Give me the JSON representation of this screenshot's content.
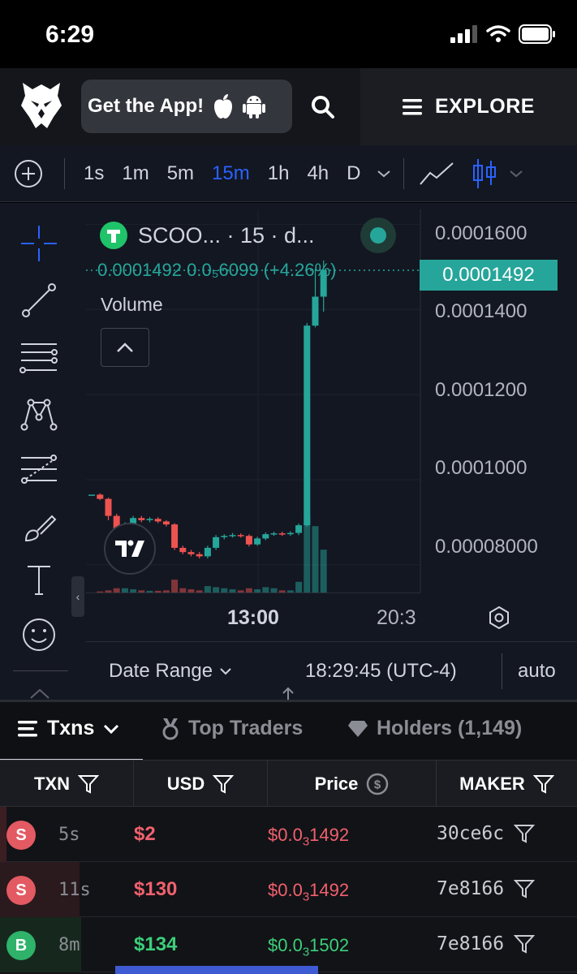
{
  "status": {
    "time": "6:29"
  },
  "nav": {
    "get_app_label": "Get the App!",
    "explore_label": "EXPLORE"
  },
  "toolbar": {
    "intervals": [
      "1s",
      "1m",
      "5m",
      "15m",
      "1h",
      "4h",
      "D"
    ],
    "active_interval": "15m"
  },
  "chart": {
    "legend_title": "SCOO...   · 15 · d...",
    "price_line": "0.0001492  0.0₅6099 (+4.26%)",
    "volume_label": "Volume",
    "current_price": "0.0001492",
    "y_ticks": [
      "0.0001600",
      "0.0001400",
      "0.0001200",
      "0.0001000",
      "0.00008000"
    ],
    "x_ticks": [
      "13:00",
      "20:3"
    ],
    "date_range_label": "Date Range",
    "clock": "18:29:45 (UTC-4)",
    "auto_label": "auto",
    "accent_up": "#26a69a",
    "accent_down": "#ef5350"
  },
  "chart_data": {
    "type": "candlestick",
    "title": "",
    "x_ticks": [
      "13:00",
      "20:3"
    ],
    "ylim": [
      7.35e-05,
      0.0001635
    ],
    "candles": [
      {
        "o": 9.65e-05,
        "c": 9.65e-05,
        "h": 9.65e-05,
        "l": 9.65e-05,
        "v": 0.0
      },
      {
        "o": 9.65e-05,
        "c": 9.55e-05,
        "h": 9.68e-05,
        "l": 9.52e-05,
        "v": 0.05
      },
      {
        "o": 9.55e-05,
        "c": 9.15e-05,
        "h": 9.58e-05,
        "l": 9.05e-05,
        "v": 0.1
      },
      {
        "o": 9.15e-05,
        "c": 8.75e-05,
        "h": 9.2e-05,
        "l": 8.68e-05,
        "v": 0.2
      },
      {
        "o": 8.75e-05,
        "c": 8.95e-05,
        "h": 9e-05,
        "l": 8.7e-05,
        "v": 0.2
      },
      {
        "o": 8.95e-05,
        "c": 9.1e-05,
        "h": 9.15e-05,
        "l": 8.9e-05,
        "v": 0.15
      },
      {
        "o": 9.1e-05,
        "c": 9.05e-05,
        "h": 9.15e-05,
        "l": 9e-05,
        "v": 0.1
      },
      {
        "o": 9.05e-05,
        "c": 9.08e-05,
        "h": 9.12e-05,
        "l": 9e-05,
        "v": 0.08
      },
      {
        "o": 9.08e-05,
        "c": 9.02e-05,
        "h": 9.12e-05,
        "l": 8.98e-05,
        "v": 0.08
      },
      {
        "o": 9.02e-05,
        "c": 8.95e-05,
        "h": 9.05e-05,
        "l": 8.9e-05,
        "v": 0.1
      },
      {
        "o": 8.95e-05,
        "c": 8.4e-05,
        "h": 8.98e-05,
        "l": 8.35e-05,
        "v": 0.6
      },
      {
        "o": 8.4e-05,
        "c": 8.3e-05,
        "h": 8.45e-05,
        "l": 8.25e-05,
        "v": 0.2
      },
      {
        "o": 8.3e-05,
        "c": 8.25e-05,
        "h": 8.35e-05,
        "l": 8.2e-05,
        "v": 0.15
      },
      {
        "o": 8.25e-05,
        "c": 8.2e-05,
        "h": 8.3e-05,
        "l": 8.15e-05,
        "v": 0.1
      },
      {
        "o": 8.2e-05,
        "c": 8.4e-05,
        "h": 8.45e-05,
        "l": 8.15e-05,
        "v": 0.3
      },
      {
        "o": 8.4e-05,
        "c": 8.65e-05,
        "h": 8.7e-05,
        "l": 8.35e-05,
        "v": 0.25
      },
      {
        "o": 8.65e-05,
        "c": 8.68e-05,
        "h": 8.72e-05,
        "l": 8.6e-05,
        "v": 0.2
      },
      {
        "o": 8.68e-05,
        "c": 8.7e-05,
        "h": 8.75e-05,
        "l": 8.64e-05,
        "v": 0.15
      },
      {
        "o": 8.7e-05,
        "c": 8.68e-05,
        "h": 8.74e-05,
        "l": 8.64e-05,
        "v": 0.1
      },
      {
        "o": 8.68e-05,
        "c": 8.48e-05,
        "h": 8.72e-05,
        "l": 8.43e-05,
        "v": 0.2
      },
      {
        "o": 8.48e-05,
        "c": 8.62e-05,
        "h": 8.66e-05,
        "l": 8.45e-05,
        "v": 0.15
      },
      {
        "o": 8.62e-05,
        "c": 8.72e-05,
        "h": 8.76e-05,
        "l": 8.58e-05,
        "v": 0.25
      },
      {
        "o": 8.72e-05,
        "c": 8.74e-05,
        "h": 8.78e-05,
        "l": 8.68e-05,
        "v": 0.2
      },
      {
        "o": 8.74e-05,
        "c": 8.72e-05,
        "h": 8.78e-05,
        "l": 8.68e-05,
        "v": 0.1
      },
      {
        "o": 8.72e-05,
        "c": 8.75e-05,
        "h": 8.79e-05,
        "l": 8.68e-05,
        "v": 0.1
      },
      {
        "o": 8.75e-05,
        "c": 8.93e-05,
        "h": 8.97e-05,
        "l": 8.7e-05,
        "v": 0.5
      },
      {
        "o": 8.93e-05,
        "c": 0.0001362,
        "h": 0.0001368,
        "l": 8.9e-05,
        "v": 3.6
      },
      {
        "o": 0.0001362,
        "c": 0.000143,
        "h": 0.0001495,
        "l": 0.0001358,
        "v": 3.1
      },
      {
        "o": 0.000143,
        "c": 0.0001492,
        "h": 0.0001515,
        "l": 0.0001395,
        "v": 2.0
      }
    ]
  },
  "txn_tabs": [
    {
      "label": "Txns"
    },
    {
      "label": "Top Traders"
    },
    {
      "label": "Holders (1,149)"
    }
  ],
  "table": {
    "headers": [
      "TXN",
      "USD",
      "Price",
      "MAKER"
    ],
    "rows": [
      {
        "type": "S",
        "age": "5s",
        "usd": "$2",
        "price_prefix": "$0.0",
        "price_sub": "3",
        "price_digits": "1492",
        "maker": "30ce6c"
      },
      {
        "type": "S",
        "age": "11s",
        "usd": "$130",
        "price_prefix": "$0.0",
        "price_sub": "3",
        "price_digits": "1492",
        "maker": "7e8166"
      },
      {
        "type": "B",
        "age": "8m",
        "usd": "$134",
        "price_prefix": "$0.0",
        "price_sub": "3",
        "price_digits": "1502",
        "maker": "7e8166"
      }
    ]
  }
}
